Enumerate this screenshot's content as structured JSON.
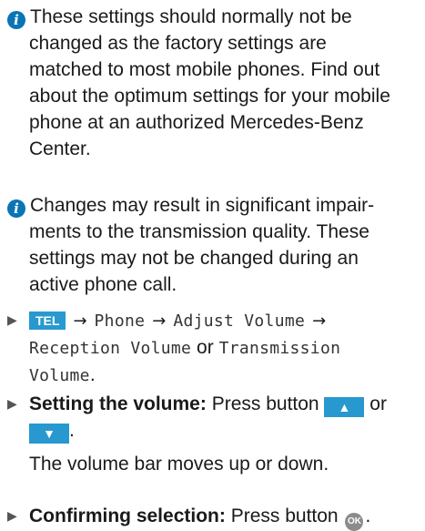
{
  "notes": [
    {
      "icon": "info-icon",
      "lines": [
        "These settings should normally not be",
        "changed as the factory settings are",
        "matched to most mobile phones. Find out",
        "about the optimum settings for your mobile",
        "phone at an authorized Mercedes-Benz",
        "Center."
      ]
    },
    {
      "icon": "info-icon",
      "lines": [
        "Changes may result in significant impair-",
        "ments to the transmission quality. These",
        "settings may not be changed during an",
        "active phone call."
      ]
    }
  ],
  "steps": {
    "menu_path": {
      "tel_key": "TEL",
      "phone": "Phone",
      "adjust_volume": "Adjust Volume",
      "reception_volume": "Reception Volume",
      "or": "or",
      "transmission": "Transmission",
      "volume": "Volume",
      "period": "."
    },
    "setting_volume": {
      "label": "Setting the volume:",
      "text": "Press button",
      "or": "or",
      "up_symbol": "▲",
      "down_symbol": "▼",
      "period": ".",
      "result": "The volume bar moves up or down."
    },
    "confirm": {
      "label": "Confirming selection:",
      "text": "Press button",
      "ok_label": "OK",
      "period": "."
    }
  },
  "bullet_symbol": "▶",
  "arrow_symbol": "→",
  "info_symbol": "i"
}
